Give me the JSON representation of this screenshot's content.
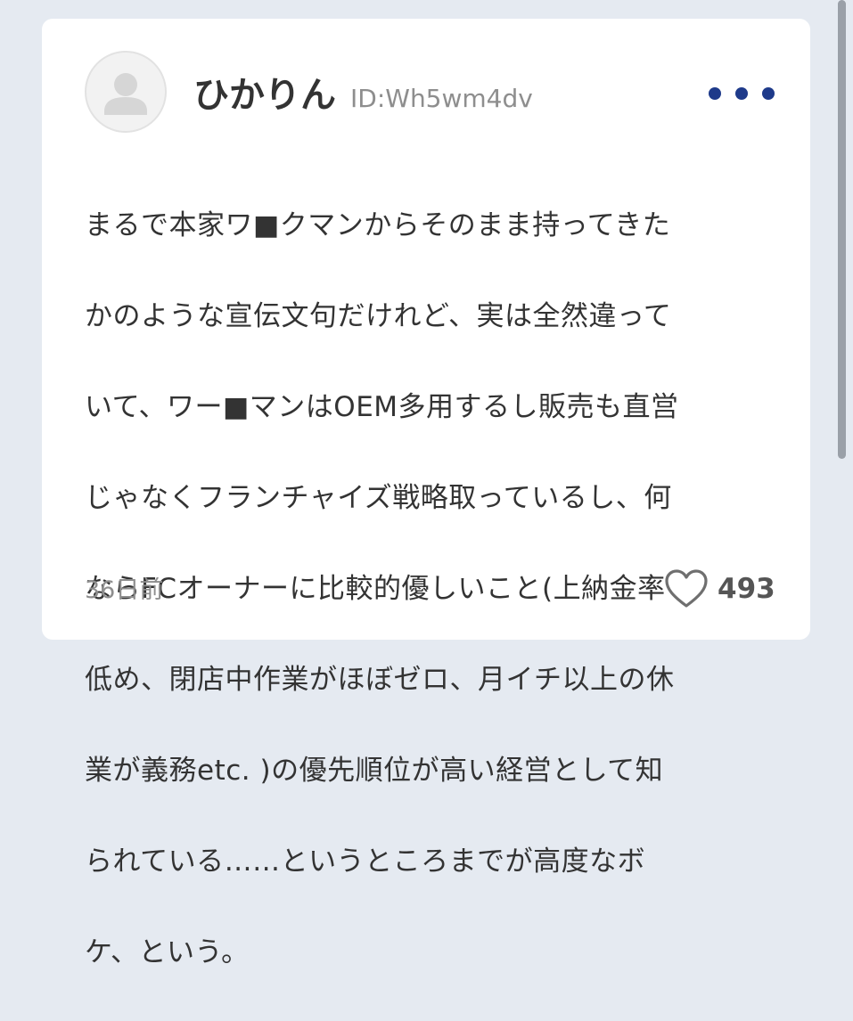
{
  "post": {
    "author_name": "ひかりん",
    "author_id": "ID:Wh5wm4dv",
    "body_lines": [
      "まるで本家ワ■クマンからそのまま持ってきた",
      "かのような宣伝文句だけれど、実は全然違って",
      "いて、ワー■マンはOEM多用するし販売も直営",
      "じゃなくフランチャイズ戦略取っているし、何",
      "ならFCオーナーに比較的優しいこと(上納金率",
      "低め、閉店中作業がほぼゼロ、月イチ以上の休",
      "業が義務etc. )の優先順位が高い経営として知",
      "られている……というところまでが高度なボ",
      "ケ、という。"
    ],
    "timestamp": "36日前",
    "like_count": "493"
  },
  "icons": {
    "avatar": "default-user-avatar-icon",
    "more": "more-horizontal-icon",
    "like": "heart-outline-icon"
  },
  "colors": {
    "background": "#e5eaf1",
    "card": "#ffffff",
    "accent_dots": "#1e3a8a",
    "text": "#333333",
    "muted": "#8e8e8e"
  }
}
